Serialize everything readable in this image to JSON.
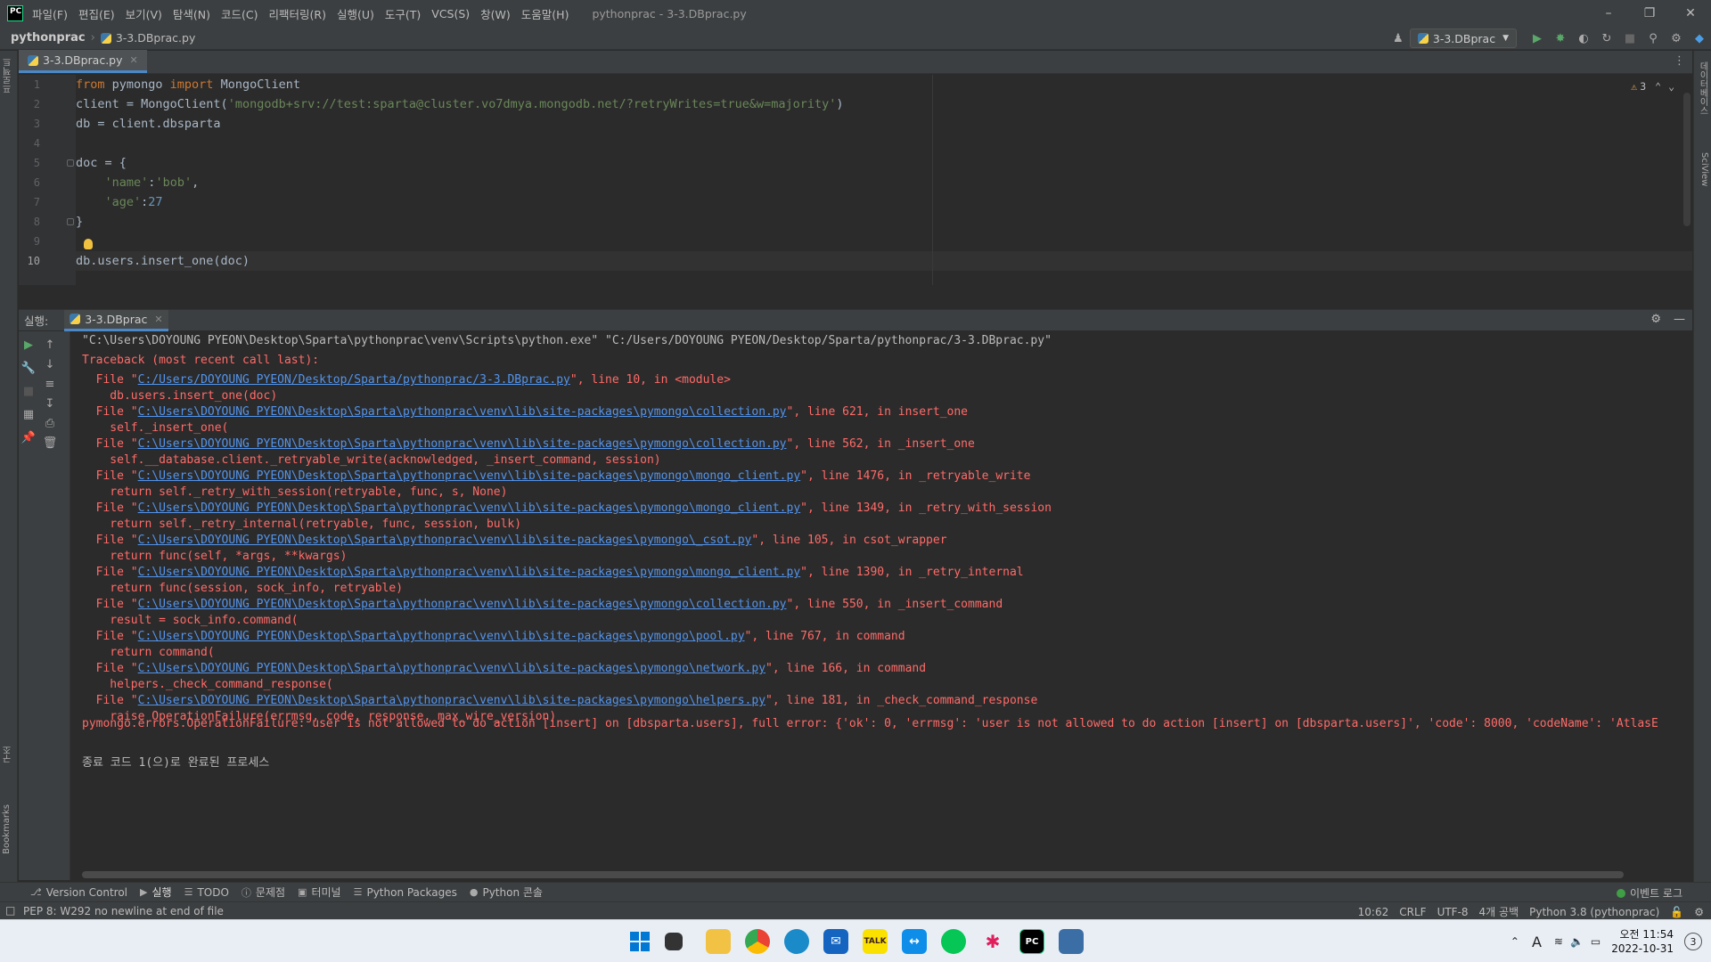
{
  "menu": [
    "파일(F)",
    "편집(E)",
    "보기(V)",
    "탐색(N)",
    "코드(C)",
    "리팩터링(R)",
    "실행(U)",
    "도구(T)",
    "VCS(S)",
    "창(W)",
    "도움말(H)"
  ],
  "window_title": "pythonprac - 3-3.DBprac.py",
  "app_logo": "PC",
  "breadcrumb": {
    "project": "pythonprac",
    "file": "3-3.DBprac.py"
  },
  "run_config": "3-3.DBprac",
  "editor": {
    "tab": "3-3.DBprac.py",
    "inspection_count": "3",
    "line_numbers": [
      "1",
      "2",
      "3",
      "4",
      "5",
      "6",
      "7",
      "8",
      "9",
      "10"
    ],
    "line1": {
      "k1": "from",
      "m": " pymongo ",
      "k2": "import",
      "rest": " MongoClient"
    },
    "line2": {
      "pre": "client = MongoClient(",
      "str": "'mongodb+srv://test:sparta@cluster.vo7dmya.mongodb.net/?retryWrites=true&w=majority'",
      "post": ")"
    },
    "line3": "db = client.dbsparta",
    "line5": "doc = {",
    "line6": {
      "key": "'name'",
      "sep": ":",
      "val": "'bob'",
      "tail": ","
    },
    "line7": {
      "key": "'age'",
      "sep": ":",
      "val": "27"
    },
    "line8": "}",
    "line10": "db.users.insert_one(doc)"
  },
  "run": {
    "title": "실행:",
    "tab": "3-3.DBprac",
    "command": "\"C:\\Users\\DOYOUNG PYEON\\Desktop\\Sparta\\pythonprac\\venv\\Scripts\\python.exe\" \"C:/Users/DOYOUNG PYEON/Desktop/Sparta/pythonprac/3-3.DBprac.py\"",
    "traceback": "Traceback (most recent call last):",
    "frames": [
      {
        "path": "C:/Users/DOYOUNG PYEON/Desktop/Sparta/pythonprac/3-3.DBprac.py",
        "loc": "\", line 10, in <module>",
        "code": "    db.users.insert_one(doc)"
      },
      {
        "path": "C:\\Users\\DOYOUNG PYEON\\Desktop\\Sparta\\pythonprac\\venv\\lib\\site-packages\\pymongo\\collection.py",
        "loc": "\", line 621, in insert_one",
        "code": "    self._insert_one("
      },
      {
        "path": "C:\\Users\\DOYOUNG PYEON\\Desktop\\Sparta\\pythonprac\\venv\\lib\\site-packages\\pymongo\\collection.py",
        "loc": "\", line 562, in _insert_one",
        "code": "    self.__database.client._retryable_write(acknowledged, _insert_command, session)"
      },
      {
        "path": "C:\\Users\\DOYOUNG PYEON\\Desktop\\Sparta\\pythonprac\\venv\\lib\\site-packages\\pymongo\\mongo_client.py",
        "loc": "\", line 1476, in _retryable_write",
        "code": "    return self._retry_with_session(retryable, func, s, None)"
      },
      {
        "path": "C:\\Users\\DOYOUNG PYEON\\Desktop\\Sparta\\pythonprac\\venv\\lib\\site-packages\\pymongo\\mongo_client.py",
        "loc": "\", line 1349, in _retry_with_session",
        "code": "    return self._retry_internal(retryable, func, session, bulk)"
      },
      {
        "path": "C:\\Users\\DOYOUNG PYEON\\Desktop\\Sparta\\pythonprac\\venv\\lib\\site-packages\\pymongo\\_csot.py",
        "loc": "\", line 105, in csot_wrapper",
        "code": "    return func(self, *args, **kwargs)"
      },
      {
        "path": "C:\\Users\\DOYOUNG PYEON\\Desktop\\Sparta\\pythonprac\\venv\\lib\\site-packages\\pymongo\\mongo_client.py",
        "loc": "\", line 1390, in _retry_internal",
        "code": "    return func(session, sock_info, retryable)"
      },
      {
        "path": "C:\\Users\\DOYOUNG PYEON\\Desktop\\Sparta\\pythonprac\\venv\\lib\\site-packages\\pymongo\\collection.py",
        "loc": "\", line 550, in _insert_command",
        "code": "    result = sock_info.command("
      },
      {
        "path": "C:\\Users\\DOYOUNG PYEON\\Desktop\\Sparta\\pythonprac\\venv\\lib\\site-packages\\pymongo\\pool.py",
        "loc": "\", line 767, in command",
        "code": "    return command("
      },
      {
        "path": "C:\\Users\\DOYOUNG PYEON\\Desktop\\Sparta\\pythonprac\\venv\\lib\\site-packages\\pymongo\\network.py",
        "loc": "\", line 166, in command",
        "code": "    helpers._check_command_response("
      },
      {
        "path": "C:\\Users\\DOYOUNG PYEON\\Desktop\\Sparta\\pythonprac\\venv\\lib\\site-packages\\pymongo\\helpers.py",
        "loc": "\", line 181, in _check_command_response",
        "code": "    raise OperationFailure(errmsg, code, response, max_wire_version)"
      }
    ],
    "file_prefix": "  File \"",
    "error": "pymongo.errors.OperationFailure: user is not allowed to do action [insert] on [dbsparta.users], full error: {'ok': 0, 'errmsg': 'user is not allowed to do action [insert] on [dbsparta.users]', 'code': 8000, 'codeName': 'AtlasE",
    "exit": "종료 코드 1(으)로 완료된 프로세스"
  },
  "tool_tabs": [
    "Version Control",
    "실행",
    "TODO",
    "문제점",
    "터미널",
    "Python Packages",
    "Python 콘솔"
  ],
  "event_log": "이벤트 로그",
  "status": {
    "message": "PEP 8: W292 no newline at end of file",
    "position": "10:62",
    "line_sep": "CRLF",
    "encoding": "UTF-8",
    "indent": "4개 공백",
    "interpreter": "Python 3.8 (pythonprac)"
  },
  "left_strip": {
    "project": "프로젝트",
    "structure": "구조",
    "bookmarks": "Bookmarks"
  },
  "right_strip": {
    "database": "데이터베이스",
    "sciview": "SciView"
  },
  "taskbar": {
    "ime": "A",
    "clock_ampm": "오전 11:54",
    "date": "2022-10-31",
    "notifications": "3"
  },
  "colors": {
    "accent": "#4a88c7",
    "error": "#ff6b68",
    "link": "#5394ec",
    "keyword": "#cc7832",
    "string": "#6a8759"
  }
}
